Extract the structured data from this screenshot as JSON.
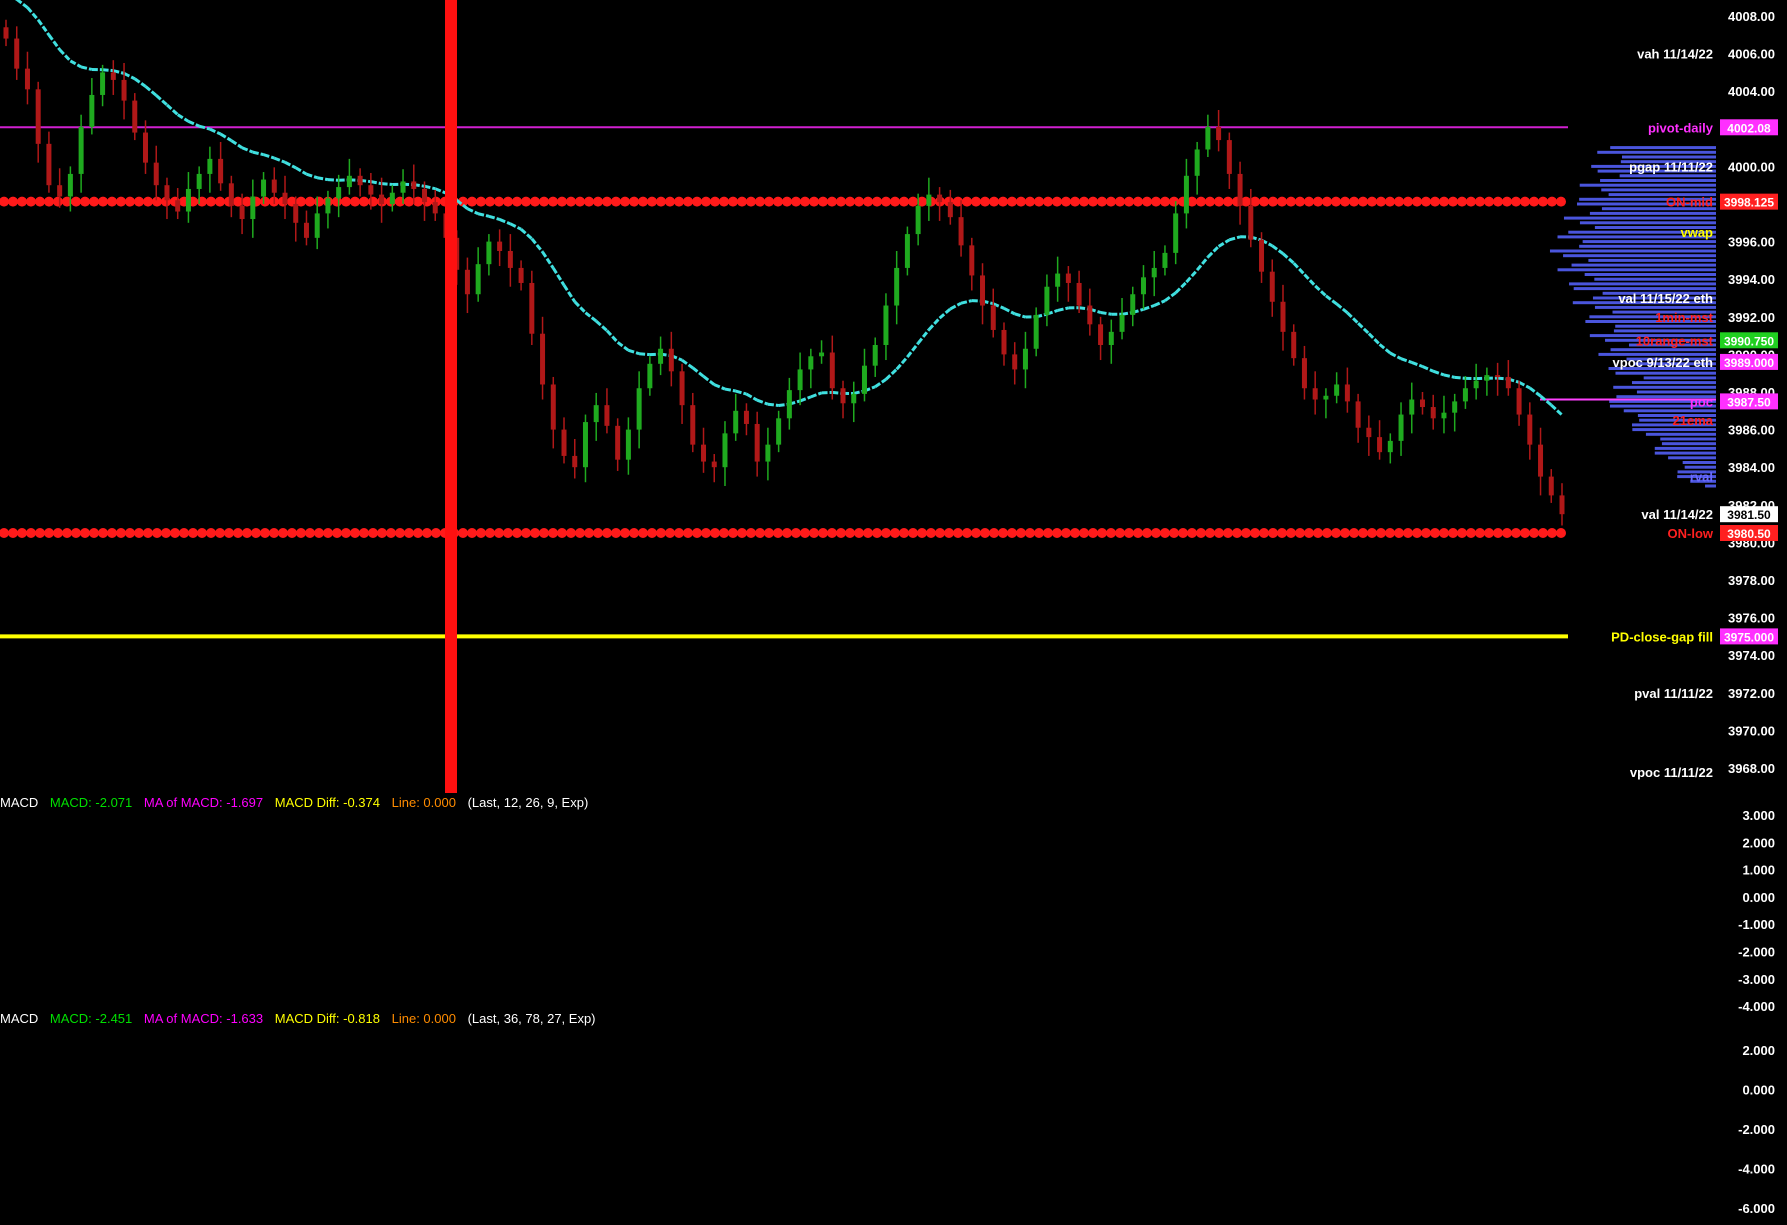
{
  "colors": {
    "background": "#000000",
    "up_candle": "#1faa1f",
    "down_candle": "#b01818",
    "ema": "#40e0e0",
    "volume_profile": "#4a55dd",
    "pivot_line": "#d020d0",
    "on_dots": "#ff1a1a",
    "gap_fill_line": "#ffff00",
    "cursor_bar": "#ff1010",
    "macd_green": "#00e000",
    "macd_magenta": "#ff00ff",
    "macd_yellow": "#ffff00",
    "macd_orange": "#ff8c00",
    "macd_white": "#ffffff"
  },
  "price_axis": {
    "ticks": [
      "4008.00",
      "4006.00",
      "4004.00",
      "4000.00",
      "3996.00",
      "3994.00",
      "3992.00",
      "3990.00",
      "3988.00",
      "3986.00",
      "3984.00",
      "3982.00",
      "3980.00",
      "3978.00",
      "3976.00",
      "3974.00",
      "3972.00",
      "3970.00",
      "3968.00"
    ]
  },
  "level_labels": [
    {
      "text": "vah 11/14/22",
      "price": 4006.0,
      "color": "#ffffff",
      "box": "",
      "box_bg": ""
    },
    {
      "text": "pivot-daily",
      "price": 4002.08,
      "color": "#ff30ff",
      "box": "4002.08",
      "box_bg": "#ff30ff"
    },
    {
      "text": "pgap 11/11/22",
      "price": 4000.0,
      "color": "#ffffff",
      "box": "",
      "box_bg": ""
    },
    {
      "text": "ON-mid",
      "price": 3998.125,
      "color": "#ff2020",
      "box": "3998.125",
      "box_bg": "#ff2020"
    },
    {
      "text": "vwap",
      "price": 3996.5,
      "color": "#ffff00",
      "box": "",
      "box_bg": ""
    },
    {
      "text": "val 11/15/22 eth",
      "price": 3993.0,
      "color": "#ffffff",
      "box": "",
      "box_bg": ""
    },
    {
      "text": "1min-mst",
      "price": 3992.0,
      "color": "#ff2020",
      "box": "",
      "box_bg": ""
    },
    {
      "text": "10range-mst",
      "price": 3990.75,
      "color": "#ff2020",
      "box": "3990.750",
      "box_bg": "#20d020"
    },
    {
      "text": "vpoc 9/13/22 eth",
      "price": 3989.6,
      "color": "#ffffff",
      "box": "3989.000",
      "box_bg": "#ff30ff"
    },
    {
      "text": "poc",
      "price": 3987.5,
      "color": "#ff30ff",
      "box": "3987.50",
      "box_bg": "#ff30ff"
    },
    {
      "text": "21ema",
      "price": 3986.5,
      "color": "#ff2020",
      "box": "",
      "box_bg": ""
    },
    {
      "text": "rval",
      "price": 3983.5,
      "color": "#6a6aff",
      "box": "",
      "box_bg": ""
    },
    {
      "text": "val 11/14/22",
      "price": 3981.5,
      "color": "#ffffff",
      "box": "3981.50",
      "box_bg": "#ffffff"
    },
    {
      "text": "ON-low",
      "price": 3980.5,
      "color": "#ff2020",
      "box": "3980.50",
      "box_bg": "#ff2020"
    },
    {
      "text": "PD-close-gap fill",
      "price": 3975.0,
      "color": "#ffff00",
      "box": "3975.000",
      "box_bg": "#ff30ff"
    },
    {
      "text": "pval 11/11/22",
      "price": 3972.0,
      "color": "#ffffff",
      "box": "",
      "box_bg": ""
    },
    {
      "text": "vpoc 11/11/22",
      "price": 3967.8,
      "color": "#ffffff",
      "box": "",
      "box_bg": ""
    }
  ],
  "macd1": {
    "title": "MACD",
    "macd": "MACD: -2.071",
    "ma": "MA of MACD: -1.697",
    "diff": "MACD Diff: -0.374",
    "line": "Line: 0.000",
    "params": "(Last, 12, 26, 9, Exp)",
    "ticks": [
      "3.000",
      "2.000",
      "1.000",
      "0.000",
      "-1.000",
      "-2.000",
      "-3.000",
      "-4.000"
    ]
  },
  "macd2": {
    "title": "MACD",
    "macd": "MACD: -2.451",
    "ma": "MA of MACD: -1.633",
    "diff": "MACD Diff: -0.818",
    "line": "Line: 0.000",
    "params": "(Last, 36, 78, 27, Exp)",
    "ticks": [
      "2.000",
      "0.000",
      "-2.000",
      "-4.000",
      "-6.000"
    ]
  },
  "chart_data": {
    "type": "candlestick",
    "series_count": 1,
    "ylim": [
      3967,
      4009
    ],
    "horizontal_levels": {
      "pivot_daily": 4002.08,
      "on_mid": 3998.125,
      "on_low": 3980.5,
      "pd_close_gap_fill": 3975.0
    },
    "candles_close": [
      4006.8,
      4005.2,
      4004.1,
      4001.2,
      3999.0,
      3998.4,
      3999.6,
      4002.1,
      4003.8,
      4005.0,
      4004.6,
      4003.5,
      4001.8,
      4000.2,
      3999.0,
      3998.2,
      3997.6,
      3998.8,
      3999.6,
      4000.4,
      3999.1,
      3997.9,
      3997.2,
      3998.4,
      3999.3,
      3998.6,
      3998.0,
      3997.0,
      3996.2,
      3997.5,
      3998.3,
      3998.9,
      3999.5,
      3999.0,
      3998.5,
      3998.0,
      3998.6,
      3999.2,
      3998.8,
      3998.1,
      3997.5,
      3996.2,
      3994.5,
      3993.2,
      3994.8,
      3996.0,
      3995.5,
      3994.6,
      3993.8,
      3991.1,
      3988.4,
      3986.0,
      3984.6,
      3984.0,
      3986.4,
      3987.3,
      3986.2,
      3984.4,
      3986.0,
      3988.2,
      3989.5,
      3990.3,
      3989.1,
      3987.3,
      3985.2,
      3984.3,
      3984.0,
      3985.8,
      3987.0,
      3986.3,
      3984.3,
      3985.2,
      3986.6,
      3988.1,
      3989.2,
      3989.9,
      3990.1,
      3988.2,
      3987.4,
      3987.9,
      3989.4,
      3990.5,
      3992.6,
      3994.6,
      3996.4,
      3997.9,
      3998.5,
      3998.1,
      3997.3,
      3995.8,
      3994.2,
      3992.6,
      3991.3,
      3990.0,
      3989.2,
      3990.3,
      3992.1,
      3993.6,
      3994.3,
      3993.8,
      3992.6,
      3991.6,
      3990.5,
      3991.2,
      3992.1,
      3993.2,
      3994.1,
      3994.6,
      3995.4,
      3997.5,
      3999.5,
      4000.9,
      4002.1,
      4001.4,
      3999.6,
      3997.9,
      3996.1,
      3994.4,
      3992.8,
      3991.2,
      3989.8,
      3988.2,
      3987.6,
      3987.8,
      3988.4,
      3987.5,
      3986.1,
      3985.6,
      3984.8,
      3985.4,
      3986.8,
      3987.6,
      3987.2,
      3986.6,
      3986.9,
      3987.5,
      3988.2,
      3988.6,
      3988.9,
      3988.8,
      3988.2,
      3986.8,
      3985.2,
      3983.5,
      3982.5,
      3981.5
    ]
  }
}
